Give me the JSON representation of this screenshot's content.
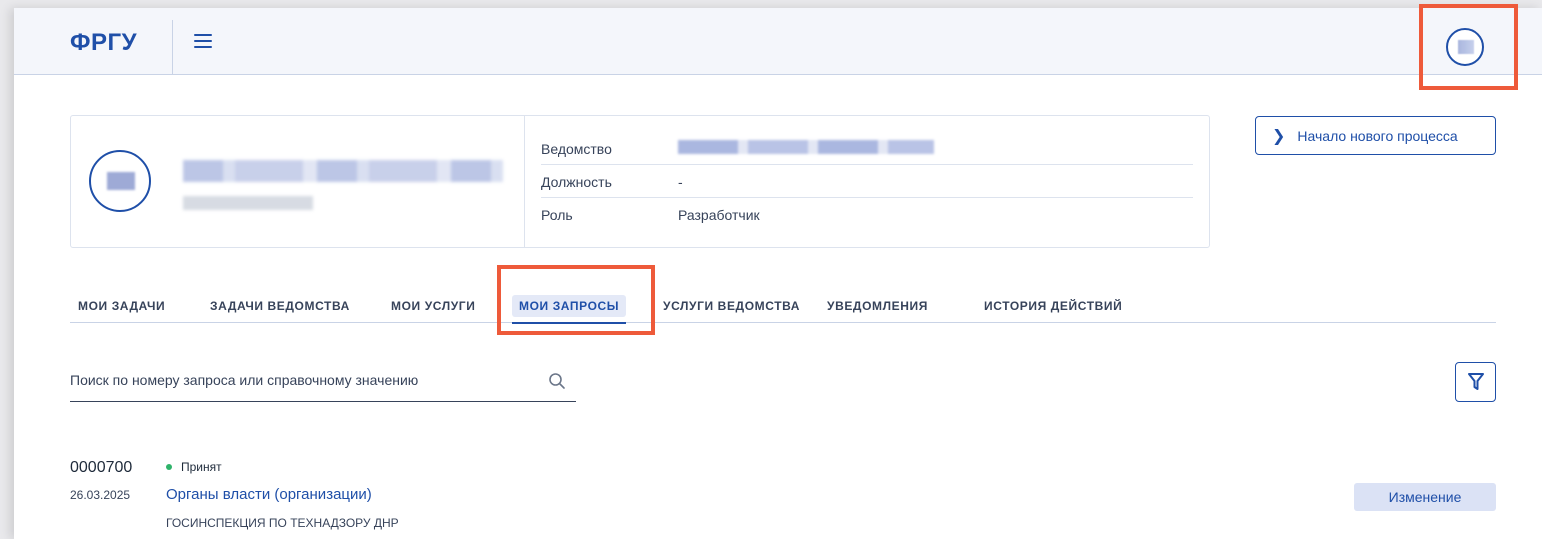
{
  "header": {
    "logo": "ФРГУ"
  },
  "profile": {
    "fields": [
      {
        "label": "Ведомство",
        "value": ""
      },
      {
        "label": "Должность",
        "value": "-"
      },
      {
        "label": "Роль",
        "value": "Разработчик"
      }
    ]
  },
  "actions": {
    "new_process": "Начало нового процесса"
  },
  "tabs": [
    {
      "label": "МОИ ЗАДАЧИ"
    },
    {
      "label": "ЗАДАЧИ ВЕДОМСТВА"
    },
    {
      "label": "МОИ УСЛУГИ"
    },
    {
      "label": "МОИ ЗАПРОСЫ",
      "active": true
    },
    {
      "label": "УСЛУГИ ВЕДОМСТВА"
    },
    {
      "label": "УВЕДОМЛЕНИЯ"
    },
    {
      "label": "ИСТОРИЯ ДЕЙСТВИЙ"
    }
  ],
  "search": {
    "placeholder": "Поиск по номеру запроса или справочному значению"
  },
  "requests": [
    {
      "number": "0000700",
      "date": "26.03.2025",
      "status": "Принят",
      "status_color": "#2fb36a",
      "title": "Органы власти (организации)",
      "organization": "ГОСИНСПЕКЦИЯ ПО ТЕХНАДЗОРУ ДНР",
      "badge": "Изменение"
    }
  ],
  "colors": {
    "accent": "#1f4fa8",
    "highlight": "#ee5a3a"
  }
}
